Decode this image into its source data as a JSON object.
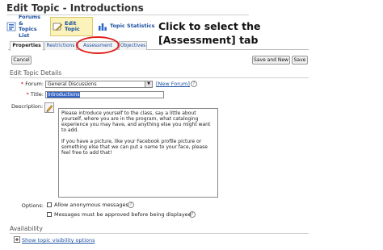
{
  "page": {
    "title": "Edit Topic - Introductions"
  },
  "nav": {
    "forums_line1": "Forums &",
    "forums_line2": "Topics List",
    "edit_topic": "Edit Topic",
    "topic_statistics": "Topic Statistics"
  },
  "annotation": {
    "line1": "Click to select the",
    "line2": "[Assessment] tab",
    "highlight_color": "#e0201b"
  },
  "tabs": [
    {
      "label": "Properties",
      "active": true
    },
    {
      "label": "Restrictions",
      "active": false
    },
    {
      "label": "Assessment",
      "active": false
    },
    {
      "label": "Objectives",
      "active": false
    }
  ],
  "toolbar": {
    "cancel_label": "Cancel",
    "save_new_label": "Save and New",
    "save_label": "Save"
  },
  "form": {
    "section_title": "Edit Topic Details",
    "required_marker": "*",
    "forum_label": "Forum:",
    "forum_value": "General Discussions",
    "new_forum_link": "[New Forum]",
    "title_label": "Title:",
    "title_value": "Introductions",
    "description_label": "Description:",
    "description_p1": "Please introduce yourself to the class, say a little about yourself, where you are in the program, what cataloging experience you may have, and anything else you might want to add.",
    "description_p2": "If you have a picture, like your Facebook profile picture or something else that we can put a name to your face, please feel free to add that!",
    "options_label": "Options:",
    "option_anonymous": "Allow anonymous messages",
    "option_approval": "Messages must be approved before being displayed"
  },
  "availability": {
    "section_title": "Availability",
    "visibility_link": "Show topic visibility options"
  },
  "icons": {
    "forums": "forums-list-icon",
    "edit": "edit-topic-icon",
    "stats": "bar-chart-icon",
    "help": "help-icon",
    "editor": "pencil-icon"
  },
  "colors": {
    "link": "#1a4fa0",
    "active_nav_bg": "#fbf3b9",
    "selection": "#3565c5"
  }
}
